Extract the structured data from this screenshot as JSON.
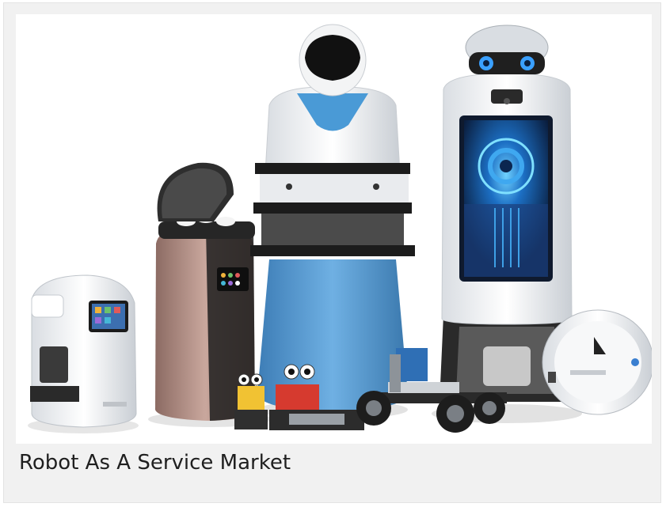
{
  "caption": "Robot As A Service Market",
  "image": {
    "subject": "robots-group-photo",
    "colors": {
      "background": "#ffffff",
      "card": "#f1f1f1",
      "accent_blue": "#4a8fc9",
      "screen_blue": "#1a5aa8",
      "bronze": "#b9938a",
      "white_plastic": "#eef0f2",
      "dark": "#1c1c1c"
    }
  }
}
